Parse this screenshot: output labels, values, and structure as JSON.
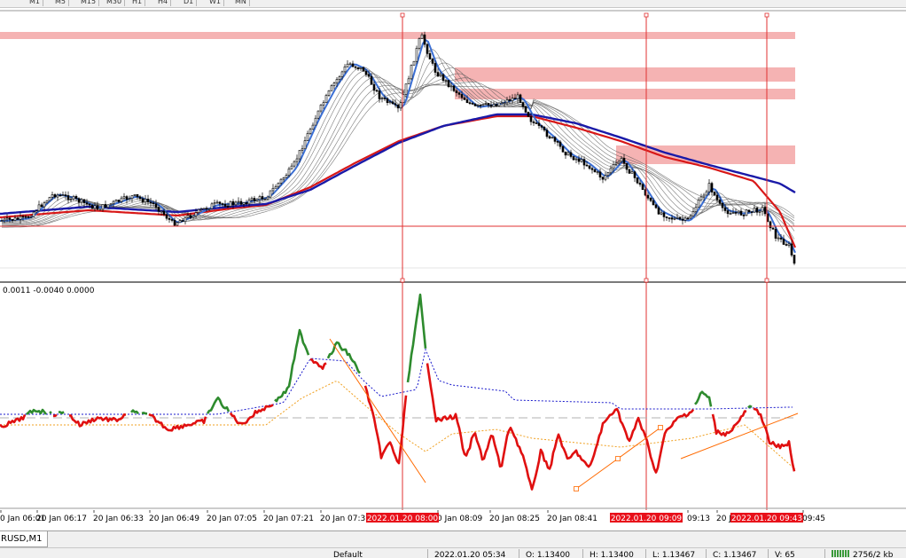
{
  "toolbar": {
    "timeframes": [
      "M1",
      "M5",
      "M15",
      "M30",
      "H1",
      "H4",
      "D1",
      "W1",
      "MN"
    ]
  },
  "indicator": {
    "label": "0.0011 -0.0040 0.0000"
  },
  "time_axis": {
    "labels": [
      "0 Jan 06:01",
      "20 Jan 06:17",
      "20 Jan 06:33",
      "20 Jan 06:49",
      "20 Jan 07:05",
      "20 Jan 07:21",
      "20 Jan 07:37",
      "0 Jan 08:09",
      "20 Jan 08:25",
      "20 Jan 08:41",
      "09:13",
      "20 J",
      "09:45"
    ],
    "cursor_labels": [
      "2022.01.20 08:00",
      "2022.01.20 09:09",
      "2022.01.20 09:43"
    ]
  },
  "symbol_tab": {
    "label": "RUSD,M1"
  },
  "status_bar": {
    "profile": "Default",
    "datetime": "2022.01.20 05:34",
    "open": "O: 1.13400",
    "high": "H: 1.13400",
    "low": "L: 1.13467",
    "close": "C: 1.13467",
    "value": "V: 65",
    "connection": "2756/2 kb"
  },
  "colors": {
    "bull_line": "#2e8b2e",
    "bear_line": "#e01010",
    "signal_line": "#1a1acc",
    "zone_fill": "#f5b3b3",
    "ema_fast": "#3b6fd4",
    "ema_red": "#d81818",
    "ema_blue": "#1a1aa8",
    "vline": "#e03030"
  }
}
